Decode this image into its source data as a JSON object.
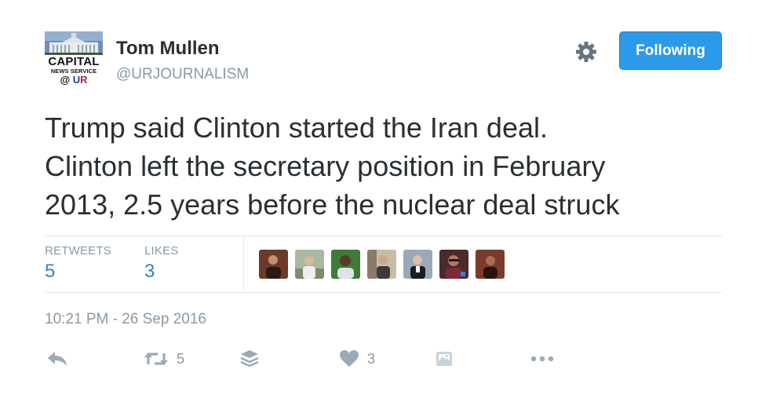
{
  "author": {
    "avatar": {
      "line1": "CAPITAL",
      "line2": "NEWS SERVICE",
      "line3_at": "@",
      "line3_u": "U",
      "line3_r": "R"
    },
    "name": "Tom Mullen",
    "handle": "@URJOURNALISM"
  },
  "header_actions": {
    "settings_icon": "gear-icon",
    "follow_label": "Following",
    "follow_color": "#2b9ae8"
  },
  "tweet": {
    "lines": [
      "Trump said Clinton started the Iran deal.",
      "Clinton left the secretary position in February",
      "2013, 2.5 years before the nuclear deal struck"
    ]
  },
  "stats": {
    "retweets_label": "RETWEETS",
    "retweets_value": "5",
    "likes_label": "LIKES",
    "likes_value": "3",
    "value_color": "#2e86c1"
  },
  "likers": [
    {
      "icon": "user-avatar",
      "color": "#6b3a2a"
    },
    {
      "icon": "user-avatar",
      "color": "#7f8a6e"
    },
    {
      "icon": "user-avatar",
      "color": "#3e7a3a"
    },
    {
      "icon": "user-avatar",
      "color": "#8a7a6a"
    },
    {
      "icon": "user-avatar",
      "color": "#9aa8b8"
    },
    {
      "icon": "user-avatar",
      "color": "#4a2a2a"
    },
    {
      "icon": "user-avatar",
      "color": "#7a3b2b"
    }
  ],
  "timestamp": "10:21 PM - 26 Sep 2016",
  "actions": {
    "reply_icon": "reply-icon",
    "retweet_icon": "retweet-icon",
    "retweet_count": "5",
    "buffer_icon": "layers-icon",
    "like_icon": "heart-icon",
    "like_count": "3",
    "moment_icon": "moment-icon",
    "more_icon": "more-icon"
  },
  "colors": {
    "muted_gray": "#8899a6",
    "text": "#292f33",
    "icon_gray": "#9aaab7"
  }
}
